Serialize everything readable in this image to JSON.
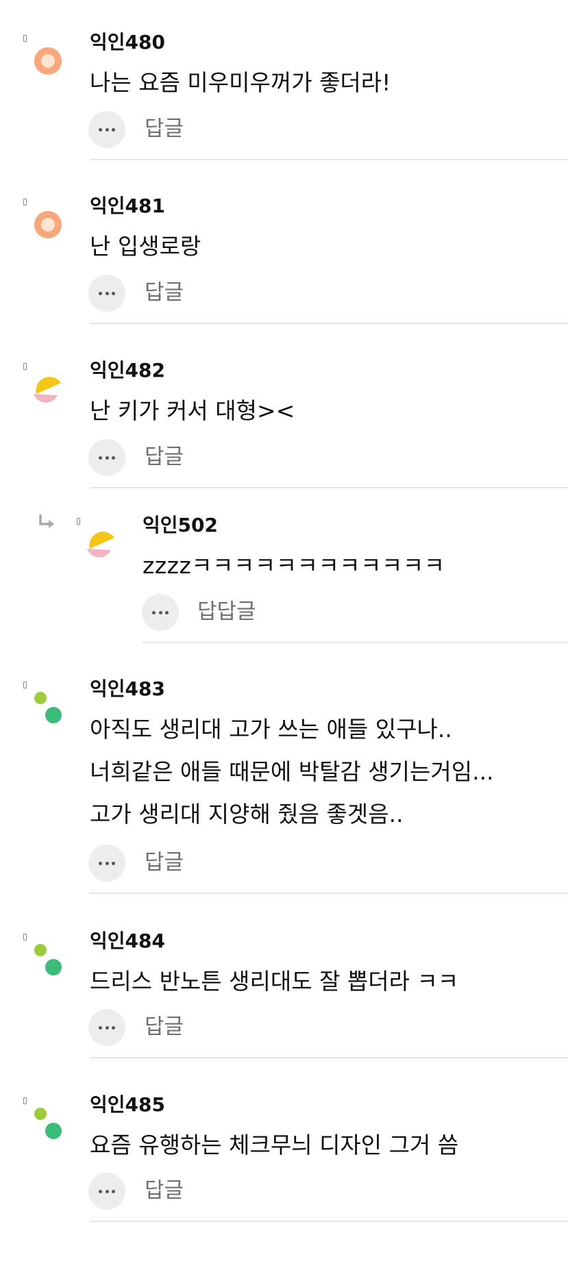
{
  "colors": {
    "avatar_orange_outer": "#f7a77b",
    "avatar_orange_inner": "#fde4d3",
    "avatar_yellow": "#f5c518",
    "avatar_pink": "#f2b4c3",
    "avatar_green_light": "#9ccc3c",
    "avatar_green_dark": "#3dbb78",
    "divider": "#e6e6e6",
    "more_button_bg": "#ededed",
    "reply_label": "#6f6f6f"
  },
  "comments": [
    {
      "author": "익인480",
      "avatar": "orange-ring-avatar-icon",
      "lines": [
        "나는 요즘 미우미우꺼가 좋더라!"
      ],
      "reply_label": "답글"
    },
    {
      "author": "익인481",
      "avatar": "orange-ring-avatar-icon",
      "lines": [
        "난 입생로랑"
      ],
      "reply_label": "답글"
    },
    {
      "author": "익인482",
      "avatar": "yellow-pink-avatar-icon",
      "lines": [
        "난 키가 커서 대형><"
      ],
      "reply_label": "답글"
    },
    {
      "author": "익인502",
      "avatar": "yellow-pink-avatar-icon",
      "is_reply": true,
      "lines": [
        "zzzzㅋㅋㅋㅋㅋㅋㅋㅋㅋㅋㅋㅋ"
      ],
      "reply_label": "답답글"
    },
    {
      "author": "익인483",
      "avatar": "green-dots-avatar-icon",
      "lines": [
        "아직도 생리대 고가 쓰는 애들 있구나..",
        "너희같은 애들 때문에 박탈감 생기는거임...",
        "고가 생리대 지양해 줬음 좋겟음.."
      ],
      "reply_label": "답글"
    },
    {
      "author": "익인484",
      "avatar": "green-dots-avatar-icon",
      "lines": [
        "드리스 반노튼 생리대도 잘 뽑더라 ㅋㅋ"
      ],
      "reply_label": "답글"
    },
    {
      "author": "익인485",
      "avatar": "green-dots-avatar-icon",
      "lines": [
        "요즘 유행하는 체크무늬 디자인 그거 씀"
      ],
      "reply_label": "답글"
    }
  ]
}
